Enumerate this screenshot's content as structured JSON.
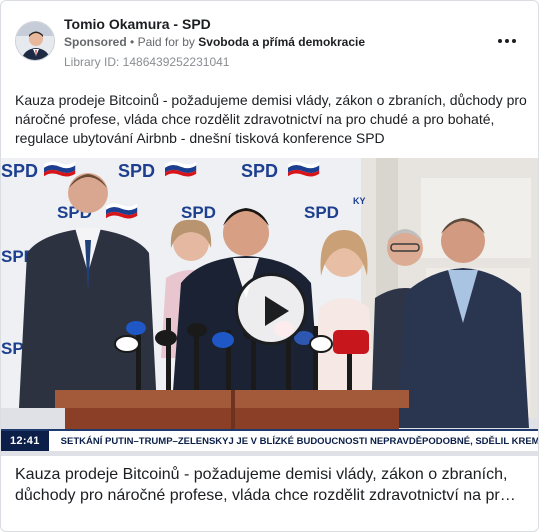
{
  "header": {
    "advertiser_name": "Tomio Okamura - SPD",
    "sponsored_label": "Sponsored",
    "separator": "•",
    "paid_for_prefix": "Paid for by",
    "paid_for_by": "Svoboda a přímá demokracie",
    "library_id": "Library ID: 1486439252231041",
    "more_icon": "more-horizontal-icon"
  },
  "post": {
    "text": "Kauza prodeje Bitcoinů - požadujeme demisi vlády, zákon o zbraních, důchody pro náročné profese, vláda chce rozdělit zdravotnictví na pro chudé a pro bohaté, regulace ubytování Airbnb - dnešní tisková konference SPD"
  },
  "video": {
    "backdrop_logo_text": "SPD",
    "backdrop_small_text": "KY",
    "ticker_time": "12:41",
    "ticker_text": "SETKÁNÍ PUTIN–TRUMP–ZELENSKYJ JE V BLÍZKÉ BUDOUCNOSTI NEPRAVDĚPODOBNÉ, SDĚLIL KREML.",
    "play_icon": "play-icon",
    "accent_colors": {
      "spd_blue": "#1d3f8f",
      "flag_red": "#d7141a",
      "ticker_navy": "#0b1f48"
    }
  },
  "caption": {
    "line1": "Kauza prodeje Bitcoinů - požadujeme demisi vlády, zákon o zbraních,",
    "line2": "důchody pro náročné profese, vláda chce rozdělit zdravotnictví na pr…"
  }
}
